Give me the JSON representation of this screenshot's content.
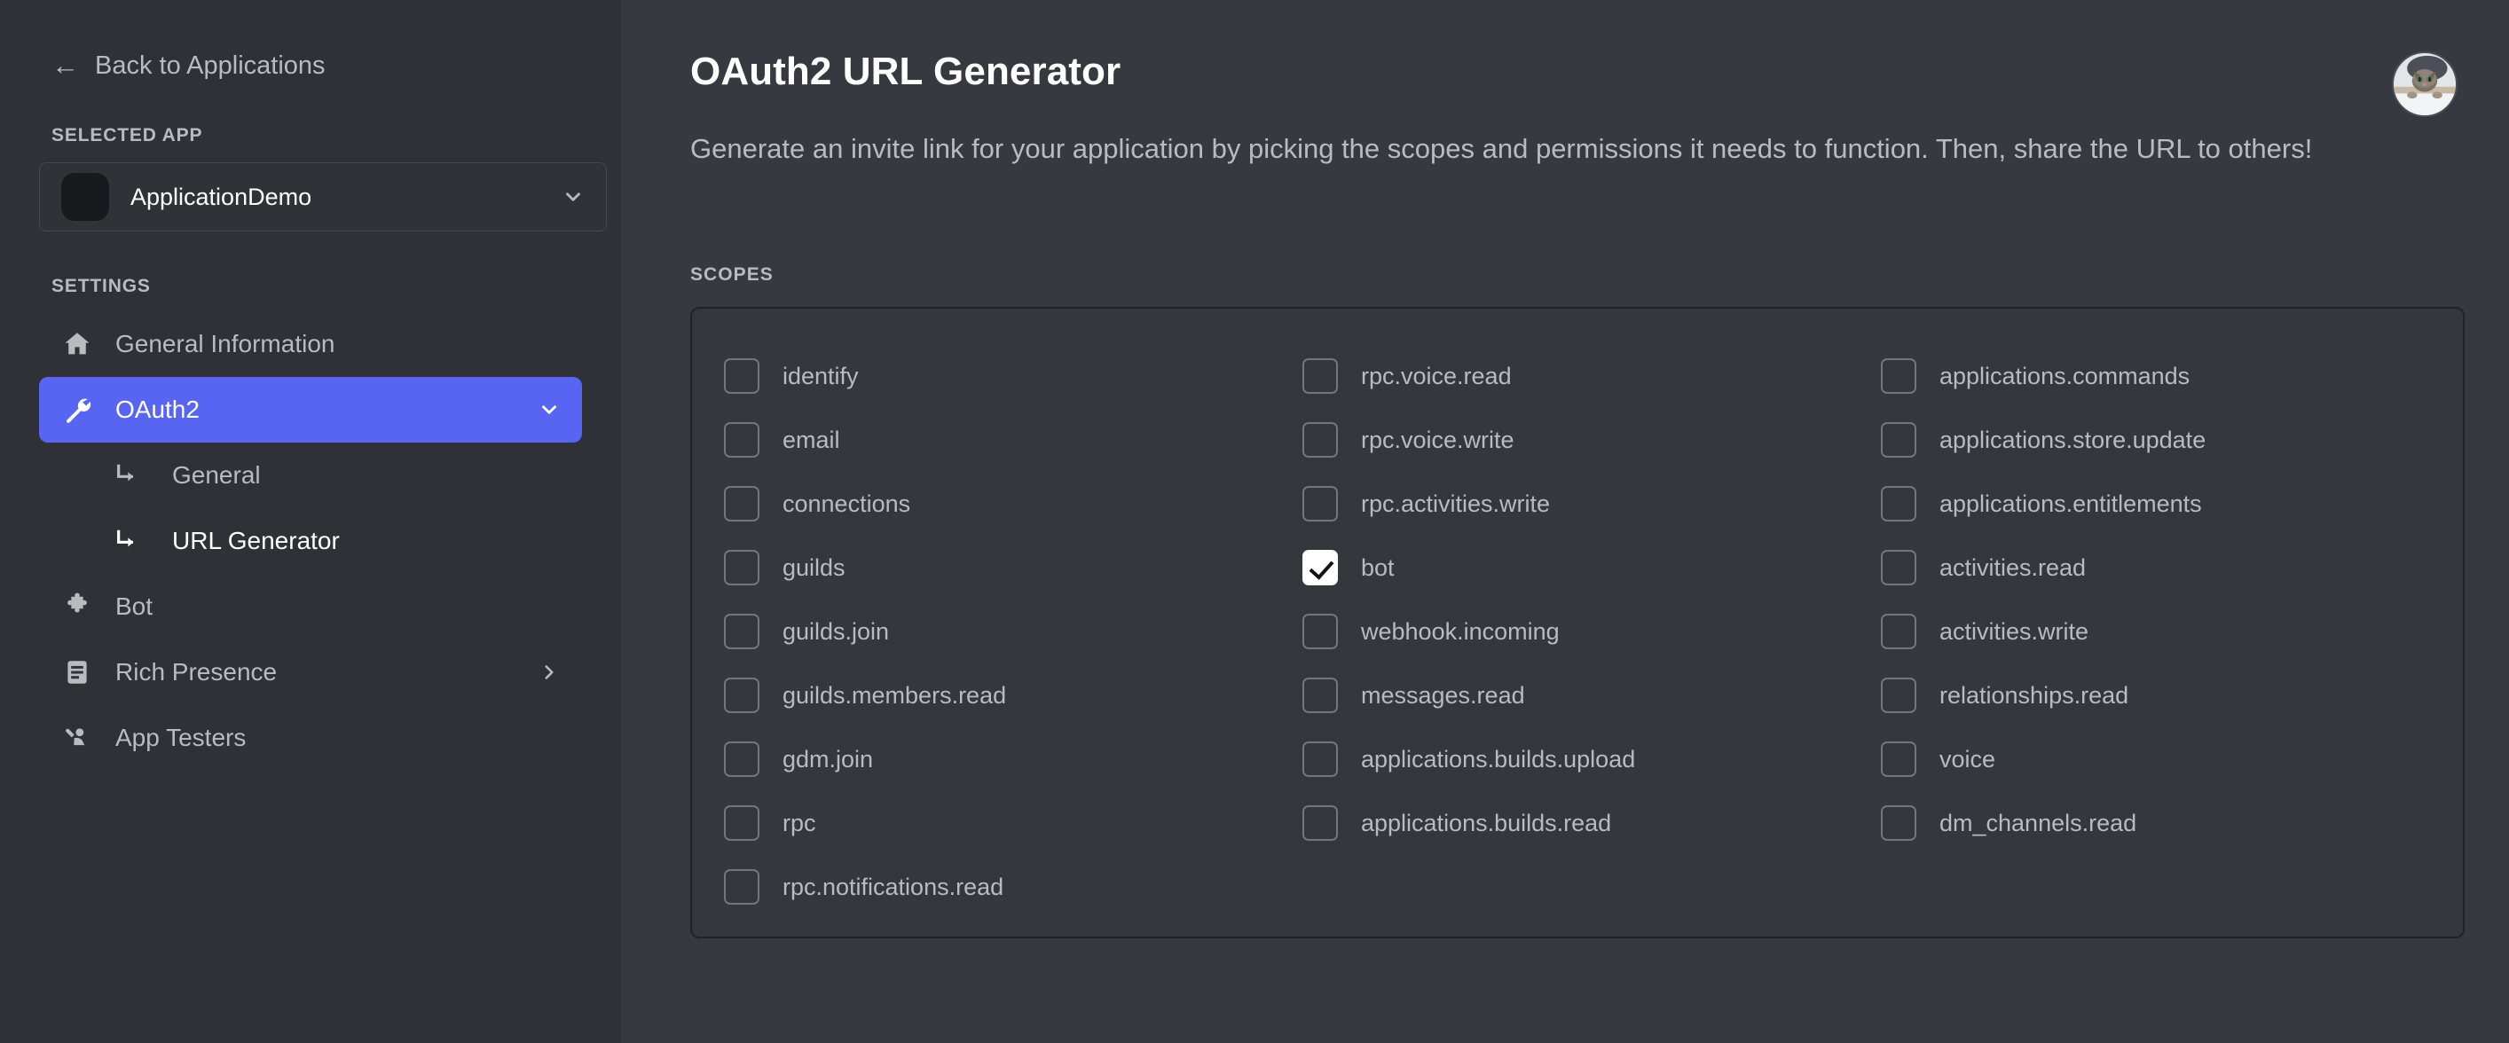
{
  "sidebar": {
    "back_link": "Back to Applications",
    "selected_app_label": "SELECTED APP",
    "selected_app_name": "ApplicationDemo",
    "settings_label": "SETTINGS",
    "nav": [
      {
        "label": "General Information",
        "icon": "home-icon",
        "active": false
      },
      {
        "label": "OAuth2",
        "icon": "wrench-icon",
        "active": true
      },
      {
        "label": "Bot",
        "icon": "puzzle-icon",
        "active": false
      },
      {
        "label": "Rich Presence",
        "icon": "document-icon",
        "active": false,
        "trailing": "chevron-right-icon"
      },
      {
        "label": "App Testers",
        "icon": "person-wave-icon",
        "active": false
      }
    ],
    "sub_items": [
      {
        "label": "General",
        "current": false
      },
      {
        "label": "URL Generator",
        "current": true
      }
    ]
  },
  "header": {
    "title": "OAuth2 URL Generator",
    "description": "Generate an invite link for your application by picking the scopes and permissions it needs to function. Then, share the URL to others!"
  },
  "scopes": {
    "label": "SCOPES",
    "columns": [
      [
        {
          "name": "identify",
          "checked": false
        },
        {
          "name": "email",
          "checked": false
        },
        {
          "name": "connections",
          "checked": false
        },
        {
          "name": "guilds",
          "checked": false
        },
        {
          "name": "guilds.join",
          "checked": false
        },
        {
          "name": "guilds.members.read",
          "checked": false
        },
        {
          "name": "gdm.join",
          "checked": false
        },
        {
          "name": "rpc",
          "checked": false
        },
        {
          "name": "rpc.notifications.read",
          "checked": false
        }
      ],
      [
        {
          "name": "rpc.voice.read",
          "checked": false
        },
        {
          "name": "rpc.voice.write",
          "checked": false
        },
        {
          "name": "rpc.activities.write",
          "checked": false
        },
        {
          "name": "bot",
          "checked": true
        },
        {
          "name": "webhook.incoming",
          "checked": false
        },
        {
          "name": "messages.read",
          "checked": false
        },
        {
          "name": "applications.builds.upload",
          "checked": false
        },
        {
          "name": "applications.builds.read",
          "checked": false
        }
      ],
      [
        {
          "name": "applications.commands",
          "checked": false
        },
        {
          "name": "applications.store.update",
          "checked": false
        },
        {
          "name": "applications.entitlements",
          "checked": false
        },
        {
          "name": "activities.read",
          "checked": false
        },
        {
          "name": "activities.write",
          "checked": false
        },
        {
          "name": "relationships.read",
          "checked": false
        },
        {
          "name": "voice",
          "checked": false
        },
        {
          "name": "dm_channels.read",
          "checked": false
        }
      ]
    ]
  },
  "colors": {
    "accent": "#5865f2",
    "sidebar_bg": "#2f3136",
    "main_bg": "#36393f",
    "panel_border": "#202225",
    "text_muted": "#b9bbbe"
  }
}
